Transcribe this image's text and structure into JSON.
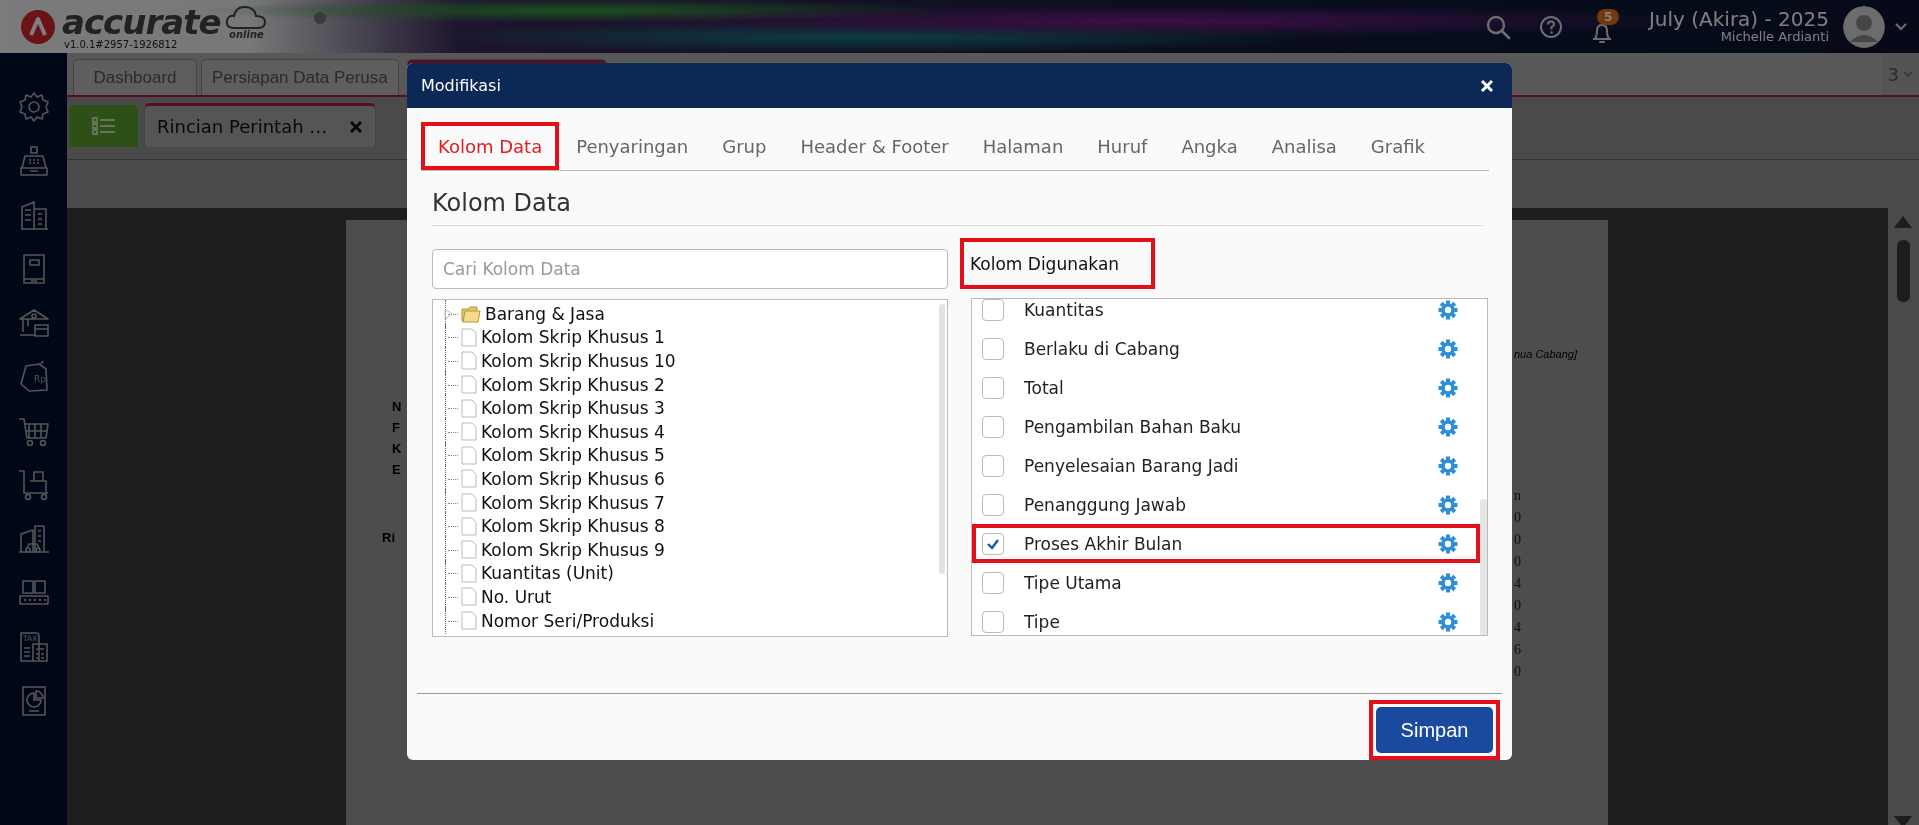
{
  "app": {
    "logo_text": "accurate",
    "logo_sub": "online",
    "version": "v1.0.1#2957-1926812"
  },
  "header": {
    "notification_count": "5",
    "period": "July (Akira) - 2025",
    "user": "Michelle Ardianti"
  },
  "sidebar": {
    "tag_icon_text": "Rp",
    "tax_icon_text": "TAX"
  },
  "tabs": [
    {
      "label": "Dashboard",
      "selected": false
    },
    {
      "label": "Persiapan Data Perusa",
      "selected": false
    },
    {
      "selected": true
    }
  ],
  "tab_count": "3",
  "subtabs": [
    {
      "label": "Rincian Perintah …"
    }
  ],
  "document": {
    "left_labels": [
      "N",
      "F",
      "K",
      "E"
    ],
    "section_label": "Ri",
    "branch_note": "nua Cabang]",
    "right_fragments": [
      "n",
      "0",
      "0",
      "0",
      "4",
      "0",
      "4",
      "6",
      "0"
    ]
  },
  "dialog": {
    "title": "Modifikasi",
    "tabs": [
      {
        "label": "Kolom Data",
        "selected": true,
        "highlighted": true
      },
      {
        "label": "Penyaringan",
        "selected": false,
        "highlighted": false
      },
      {
        "label": "Grup",
        "selected": false,
        "highlighted": false
      },
      {
        "label": "Header & Footer",
        "selected": false,
        "highlighted": false
      },
      {
        "label": "Halaman",
        "selected": false,
        "highlighted": false
      },
      {
        "label": "Huruf",
        "selected": false,
        "highlighted": false
      },
      {
        "label": "Angka",
        "selected": false,
        "highlighted": false
      },
      {
        "label": "Analisa",
        "selected": false,
        "highlighted": false
      },
      {
        "label": "Grafik",
        "selected": false,
        "highlighted": false
      }
    ],
    "section_title": "Kolom Data",
    "search": {
      "placeholder": "Cari Kolom Data"
    },
    "tree": [
      {
        "label": "Barang & Jasa",
        "kind": "folder",
        "expanded": false
      },
      {
        "label": "Kolom Skrip Khusus 1",
        "kind": "file"
      },
      {
        "label": "Kolom Skrip Khusus 10",
        "kind": "file"
      },
      {
        "label": "Kolom Skrip Khusus 2",
        "kind": "file"
      },
      {
        "label": "Kolom Skrip Khusus 3",
        "kind": "file"
      },
      {
        "label": "Kolom Skrip Khusus 4",
        "kind": "file"
      },
      {
        "label": "Kolom Skrip Khusus 5",
        "kind": "file"
      },
      {
        "label": "Kolom Skrip Khusus 6",
        "kind": "file"
      },
      {
        "label": "Kolom Skrip Khusus 7",
        "kind": "file"
      },
      {
        "label": "Kolom Skrip Khusus 8",
        "kind": "file"
      },
      {
        "label": "Kolom Skrip Khusus 9",
        "kind": "file"
      },
      {
        "label": "Kuantitas (Unit)",
        "kind": "file"
      },
      {
        "label": "No. Urut",
        "kind": "file"
      },
      {
        "label": "Nomor Seri/Produksi",
        "kind": "file"
      }
    ],
    "used_label": {
      "text": "Kolom Digunakan",
      "highlighted": true
    },
    "columns": [
      {
        "label": "Kuantitas",
        "checked": false,
        "highlighted": false
      },
      {
        "label": "Berlaku di Cabang",
        "checked": false,
        "highlighted": false
      },
      {
        "label": "Total",
        "checked": false,
        "highlighted": false
      },
      {
        "label": "Pengambilan Bahan Baku",
        "checked": false,
        "highlighted": false
      },
      {
        "label": "Penyelesaian Barang Jadi",
        "checked": false,
        "highlighted": false
      },
      {
        "label": "Penanggung Jawab",
        "checked": false,
        "highlighted": false
      },
      {
        "label": "Proses Akhir Bulan",
        "checked": true,
        "highlighted": true
      },
      {
        "label": "Tipe Utama",
        "checked": false,
        "highlighted": false
      },
      {
        "label": "Tipe",
        "checked": false,
        "highlighted": false
      }
    ],
    "save_button": {
      "label": "Simpan",
      "highlighted": true
    }
  }
}
